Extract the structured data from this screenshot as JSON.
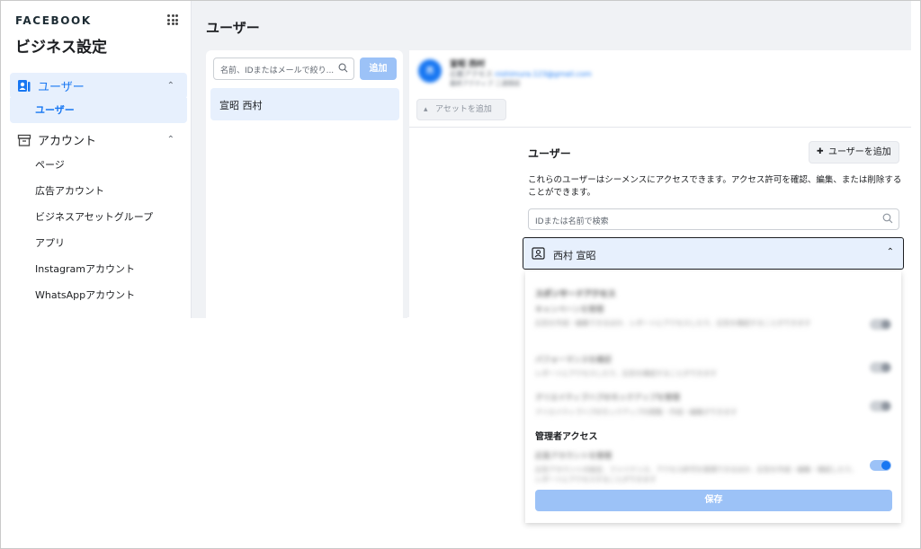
{
  "sidebar": {
    "brand": "FACEBOOK",
    "title": "ビジネス設定",
    "groups": [
      {
        "label": "ユーザー",
        "icon": "users-icon",
        "subitems": [
          "ユーザー"
        ]
      },
      {
        "label": "アカウント",
        "icon": "archive-icon",
        "subitems": [
          "ページ",
          "広告アカウント",
          "ビジネスアセットグループ",
          "アプリ",
          "Instagramアカウント",
          "WhatsAppアカウント"
        ]
      }
    ]
  },
  "header": {
    "title": "ユーザー"
  },
  "list": {
    "search_placeholder": "名前、IDまたはメールで絞り...",
    "add_label": "追加",
    "items": [
      "宣昭 西村"
    ]
  },
  "detail": {
    "avatar_initials": "西",
    "name": "宣昭 西村",
    "email_prefix": "広範アクセス",
    "email": "nishimura.123@gmail.com",
    "last_active": "最終アクティブ 二週間前",
    "add_asset_label": "アセットを追加"
  },
  "users_section": {
    "title": "ユーザー",
    "add_user_label": "ユーザーを追加",
    "description": "これらのユーザーはシーメンスにアクセスできます。アクセス許可を確認、編集、または削除することができます。",
    "search_placeholder": "IDまたは名前で検索",
    "selected_user": "西村 宣昭"
  },
  "permissions": {
    "partial_heading": "スポンサードアクセス",
    "items": [
      {
        "title": "キャンペーンを管理",
        "desc": "広告を作成・編集できるほか、レポートにアクセスしたり、広告を確認することができます",
        "on": false
      },
      {
        "title": "パフォーマンスを確認",
        "desc": "レポートにアクセスしたり、広告を確認することができます",
        "on": false
      },
      {
        "title": "クリエイティブハブのモックアップを管理",
        "desc": "クリエイティブハブのモックアップの閲覧・作成・編集ができます",
        "on": false
      }
    ],
    "admin_heading": "管理者アクセス",
    "admin_item": {
      "title": "広告アカウントを管理",
      "desc": "広告アカウントの設定、ファイナンス、アクセス許可を管理できるほか、広告を作成・編集・確認したり、レポートにアクセスすることができます",
      "on": true
    },
    "save_label": "保存"
  }
}
